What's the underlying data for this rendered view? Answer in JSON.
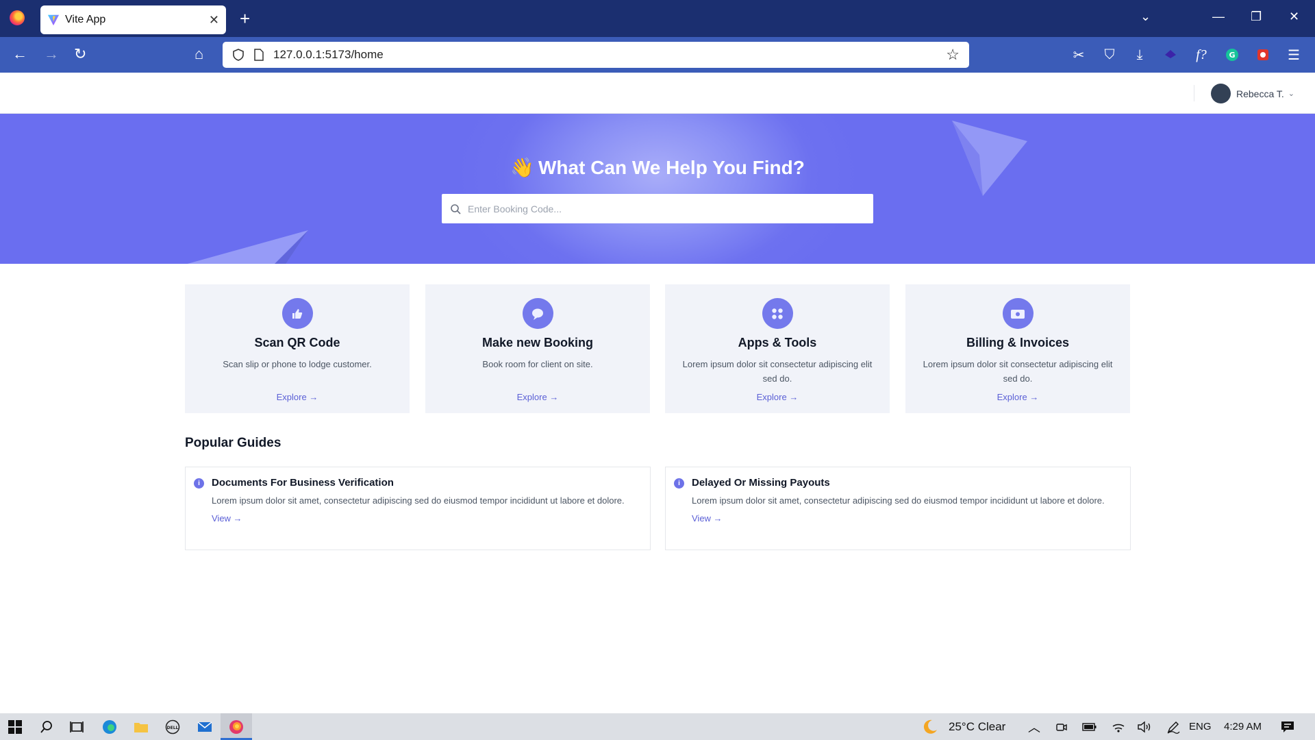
{
  "browser": {
    "tab_title": "Vite App",
    "tab_close": "✕",
    "new_tab": "+",
    "url": "127.0.0.1:5173/home",
    "window_controls": {
      "list": "⌄",
      "minimize": "—",
      "restore": "❐",
      "close": "✕"
    },
    "nav": {
      "back": "←",
      "forward": "→",
      "reload": "↻",
      "home": "⌂"
    }
  },
  "header": {
    "user_name": "Rebecca T.",
    "chevron": "⌄"
  },
  "hero": {
    "emoji": "👋",
    "title": "What Can We Help You Find?",
    "search_placeholder": "Enter Booking Code..."
  },
  "cards": [
    {
      "icon": "thumbs-up-icon",
      "title": "Scan QR Code",
      "desc": "Scan slip or phone to lodge customer.",
      "link": "Explore →"
    },
    {
      "icon": "chat-bubble-icon",
      "title": "Make new Booking",
      "desc": "Book room for client on site.",
      "link": "Explore →"
    },
    {
      "icon": "apps-icon",
      "title": "Apps & Tools",
      "desc": "Lorem ipsum dolor sit consectetur adipiscing elit sed do.",
      "link": "Explore →"
    },
    {
      "icon": "invoice-icon",
      "title": "Billing & Invoices",
      "desc": "Lorem ipsum dolor sit consectetur adipiscing elit sed do.",
      "link": "Explore →"
    }
  ],
  "guides": {
    "title": "Popular Guides",
    "items": [
      {
        "title": "Documents For Business Verification",
        "desc": "Lorem ipsum dolor sit amet, consectetur adipiscing sed do eiusmod tempor incididunt ut labore et dolore.",
        "link": "View →"
      },
      {
        "title": "Delayed Or Missing Payouts",
        "desc": "Lorem ipsum dolor sit amet, consectetur adipiscing sed do eiusmod tempor incididunt ut labore et dolore.",
        "link": "View →"
      }
    ]
  },
  "taskbar": {
    "weather": "25°C  Clear",
    "language": "ENG",
    "time": "4:29 AM"
  },
  "colors": {
    "accent": "#6d71f0",
    "tabbar": "#1b2f70",
    "navbar": "#3b5cb8",
    "link": "#5a5fd6"
  }
}
